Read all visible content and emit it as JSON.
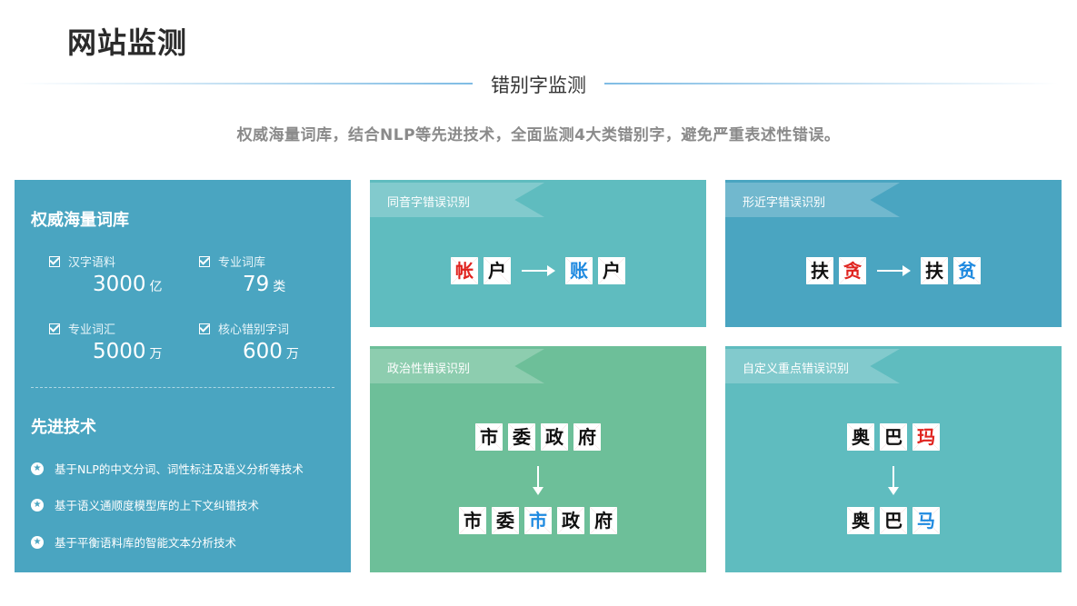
{
  "page_title": "网站监测",
  "section_title": "错别字监测",
  "subtitle": "权威海量词库，结合NLP等先进技术，全面监测4大类错别字，避免严重表述性错误。",
  "lexicon": {
    "heading": "权威海量词库",
    "stats": [
      {
        "label": "汉字语料",
        "value": "3000",
        "unit": "亿"
      },
      {
        "label": "专业词库",
        "value": "79",
        "unit": "类"
      },
      {
        "label": "专业词汇",
        "value": "5000",
        "unit": "万"
      },
      {
        "label": "核心错别字词",
        "value": "600",
        "unit": "万"
      }
    ]
  },
  "tech": {
    "heading": "先进技术",
    "items": [
      "基于NLP的中文分词、词性标注及语义分析等技术",
      "基于语义通顺度模型库的上下文纠错技术",
      "基于平衡语料库的智能文本分析技术"
    ]
  },
  "cards": {
    "homophone": {
      "label": "同音字错误识别",
      "wrong": [
        "帐",
        "户"
      ],
      "right": [
        "账",
        "户"
      ]
    },
    "similar": {
      "label": "形近字错误识别",
      "wrong": [
        "扶",
        "贪"
      ],
      "right": [
        "扶",
        "贫"
      ]
    },
    "political": {
      "label": "政治性错误识别",
      "wrong": [
        "市",
        "委",
        "政",
        "府"
      ],
      "right": [
        "市",
        "委",
        "市",
        "政",
        "府"
      ]
    },
    "custom": {
      "label": "自定义重点错误识别",
      "wrong": [
        "奥",
        "巴",
        "玛"
      ],
      "right": [
        "奥",
        "巴",
        "马"
      ]
    }
  },
  "colors": {
    "panel_blue": "#4aa5c1",
    "card_teal": "#5fbcbf",
    "card_green": "#6dbf99",
    "error_red": "#e0241f",
    "correct_blue": "#1f8ae0"
  },
  "icons": {
    "check": "checkbox-icon",
    "star": "star-badge-icon",
    "arrow": "arrow-icon"
  }
}
